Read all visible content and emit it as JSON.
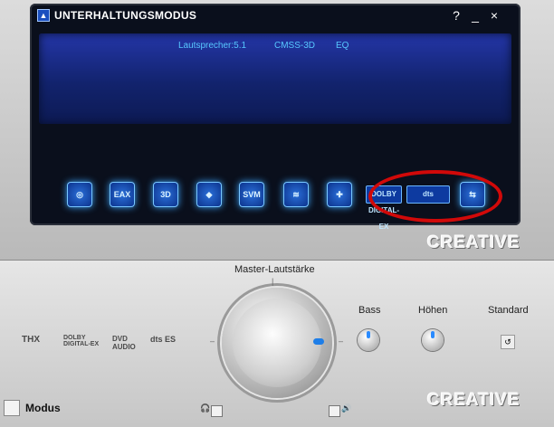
{
  "window": {
    "title": "UNTERHALTUNGSMODUS",
    "help": "?",
    "minimize": "_",
    "close": "×",
    "app_icon": "creative-app-icon"
  },
  "display": {
    "speaker": "Lautsprecher:5.1",
    "cmss": "CMSS-3D",
    "eq": "EQ"
  },
  "effect_buttons": [
    {
      "name": "speaker-settings-icon",
      "label": ""
    },
    {
      "name": "eax-icon",
      "label": "EAX"
    },
    {
      "name": "3d-icon",
      "label": "3D"
    },
    {
      "name": "wave-icon",
      "label": ""
    },
    {
      "name": "svm-icon",
      "label": "SVM"
    },
    {
      "name": "eq-icon",
      "label": ""
    },
    {
      "name": "settings-icon",
      "label": ""
    },
    {
      "name": "dolby-digital-ex-icon",
      "label": "DOLBY DIGITAL-EX"
    },
    {
      "name": "dts-icon",
      "label": "dts"
    },
    {
      "name": "mode-switch-icon",
      "label": ""
    }
  ],
  "brand": {
    "text": "CREATIVE"
  },
  "logos": [
    "THX",
    "DOLBY DIGITAL-EX",
    "DVD AUDIO",
    "dts ES"
  ],
  "master": {
    "label": "Master-Lautstärke"
  },
  "bass": {
    "label": "Bass"
  },
  "treble": {
    "label": "Höhen"
  },
  "standard": {
    "label": "Standard"
  },
  "modus": {
    "label": "Modus"
  },
  "icons": {
    "headphone": "headphone-icon",
    "speaker": "speaker-icon"
  }
}
